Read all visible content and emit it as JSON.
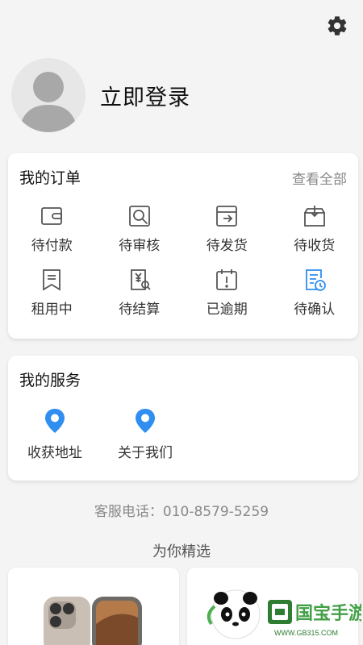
{
  "profile": {
    "login_label": "立即登录"
  },
  "orders": {
    "title": "我的订单",
    "view_all": "查看全部",
    "items": [
      {
        "label": "待付款",
        "icon": "wallet-icon"
      },
      {
        "label": "待审核",
        "icon": "review-icon"
      },
      {
        "label": "待发货",
        "icon": "ship-box-icon"
      },
      {
        "label": "待收货",
        "icon": "receive-box-icon"
      },
      {
        "label": "租用中",
        "icon": "bookmark-doc-icon"
      },
      {
        "label": "待结算",
        "icon": "yen-doc-icon"
      },
      {
        "label": "已逾期",
        "icon": "calendar-icon"
      },
      {
        "label": "待确认",
        "icon": "confirm-doc-icon"
      }
    ]
  },
  "services": {
    "title": "我的服务",
    "items": [
      {
        "label": "收获地址",
        "icon": "location-pin-icon"
      },
      {
        "label": "关于我们",
        "icon": "location-pin-icon"
      }
    ]
  },
  "contact": {
    "phone_text": "客服电话：010-8579-5259"
  },
  "recommend": {
    "title": "为你精选"
  },
  "watermark": {
    "text": "国宝手游网",
    "url": "WWW.GB315.COM"
  },
  "colors": {
    "accent_blue": "#2f8ef0",
    "icon_gray": "#555555"
  }
}
